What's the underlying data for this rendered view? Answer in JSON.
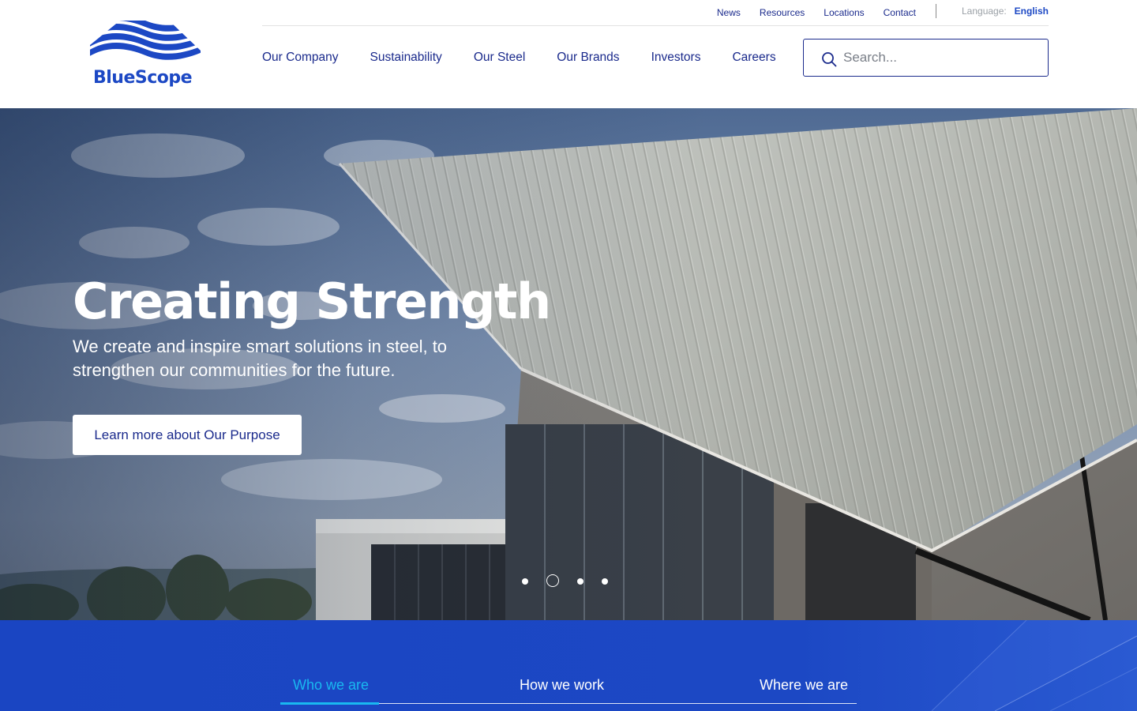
{
  "header": {
    "logo_text": "BlueScope",
    "utility_links": [
      "News",
      "Resources",
      "Locations",
      "Contact"
    ],
    "language_label": "Language:",
    "language_value": "English",
    "nav_items": [
      "Our Company",
      "Sustainability",
      "Our Steel",
      "Our Brands",
      "Investors",
      "Careers"
    ],
    "search_placeholder": "Search..."
  },
  "hero": {
    "title": "Creating Strength",
    "subtitle": "We create and inspire smart solutions in steel, to strengthen our communities for the future.",
    "cta_label": "Learn more about Our Purpose",
    "slide_count": 4,
    "active_slide": 2
  },
  "band": {
    "tabs": [
      "Who we are",
      "How we work",
      "Where we are"
    ],
    "active_tab": "Who we are"
  },
  "colors": {
    "brand_blue": "#1c48c4",
    "navy_text": "#1a2a8c",
    "accent_cyan": "#19b8f0"
  },
  "icons": {
    "search": "search-icon",
    "logo": "bluescope-waves-logo"
  }
}
